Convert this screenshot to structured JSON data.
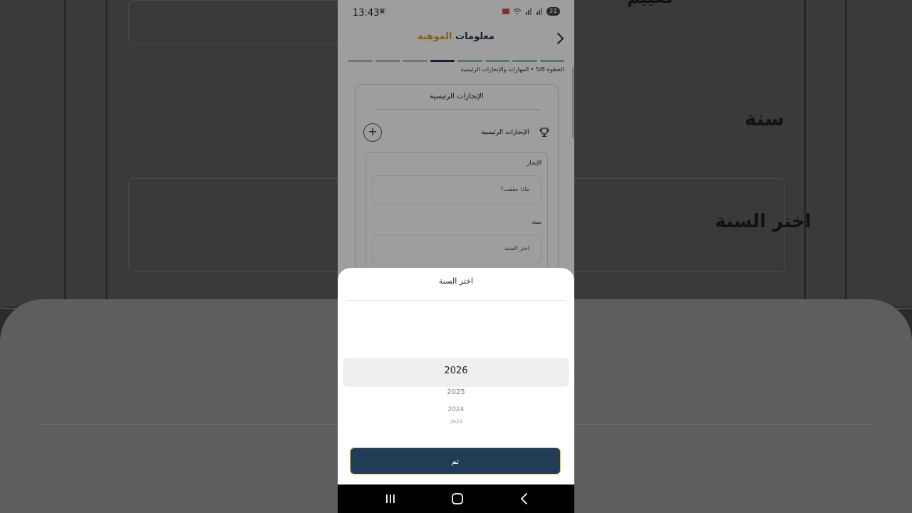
{
  "background": {
    "text_top": "تقييم",
    "text_year_label": "سنة",
    "text_select_year": "اختر السنة"
  },
  "status_bar": {
    "time": "13:43",
    "battery": "31",
    "icons": [
      "cast-icon",
      "wifi-icon",
      "signal-icon",
      "signal-icon",
      "battery-icon"
    ]
  },
  "header": {
    "title_part1": "معلومات",
    "title_part2": "الموهبة",
    "back_icon": "chevron-right-icon"
  },
  "progress": {
    "total_steps": 8,
    "current_step": 5,
    "completed_color": "#8fc2ad",
    "current_color": "#1d3551",
    "step_text": "الخطوة 5/8 • المهارات والإنجازات الرئيسية"
  },
  "form": {
    "section_title": "الإنجازات الرئيسية",
    "achievements_label": "الإنجازات الرئيسية",
    "add_button": "+",
    "achievement_label": "الإنجاز",
    "achievement_placeholder": "ماذا حققت؟",
    "year_label": "سنة",
    "year_placeholder": "اختر السنة"
  },
  "picker": {
    "title": "اختر السنة",
    "selected": "2026",
    "options": [
      "2025",
      "2024",
      "2023"
    ],
    "done_label": "تم",
    "accent": "#213c55"
  },
  "navbar": {
    "icons": [
      "recent-apps-icon",
      "home-icon",
      "back-icon"
    ]
  }
}
